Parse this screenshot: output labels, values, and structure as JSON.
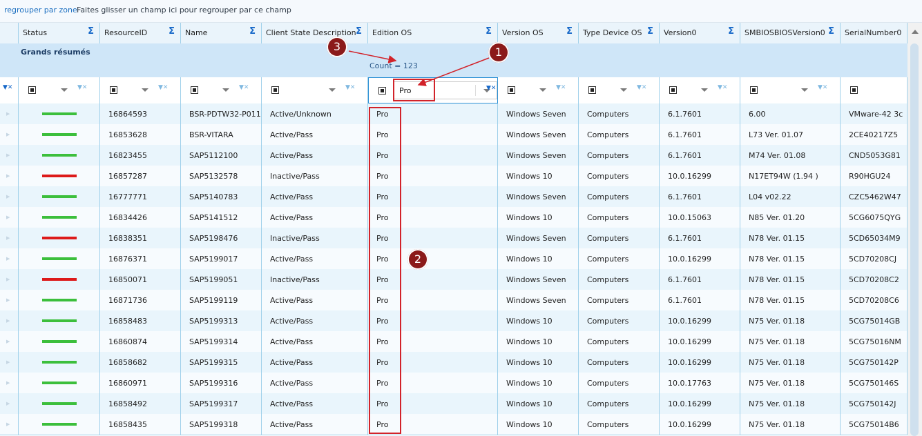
{
  "group_bar": {
    "label": "regrouper par zone",
    "hint": "Faites glisser un champ ici pour regrouper par ce champ"
  },
  "columns": [
    "Status",
    "ResourceID",
    "Name",
    "Client State Description",
    "Edition OS",
    "Version OS",
    "Type Device OS",
    "Version0",
    "SMBIOSBIOSVersion0",
    "SerialNumber0"
  ],
  "summary": {
    "title": "Grands résumés",
    "count_text": "Count = 123"
  },
  "filter": {
    "edition_os_value": "Pro"
  },
  "annotations": [
    "1",
    "2",
    "3"
  ],
  "status_colors": {
    "active": "#3cbf3c",
    "inactive": "#dd1a1a"
  },
  "rows": [
    {
      "status": "active",
      "id": "16864593",
      "name": "BSR-PDTW32-P011",
      "state": "Active/Unknown",
      "edition": "Pro",
      "version": "Windows Seven",
      "type": "Computers",
      "v0": "6.1.7601",
      "bios": "6.00",
      "serial": "VMware-42 3c"
    },
    {
      "status": "active",
      "id": "16853628",
      "name": "BSR-VITARA",
      "state": "Active/Pass",
      "edition": "Pro",
      "version": "Windows Seven",
      "type": "Computers",
      "v0": "6.1.7601",
      "bios": "L73 Ver. 01.07",
      "serial": "2CE40217Z5"
    },
    {
      "status": "active",
      "id": "16823455",
      "name": "SAP5112100",
      "state": "Active/Pass",
      "edition": "Pro",
      "version": "Windows Seven",
      "type": "Computers",
      "v0": "6.1.7601",
      "bios": "M74 Ver. 01.08",
      "serial": "CND5053G81"
    },
    {
      "status": "inactive",
      "id": "16857287",
      "name": "SAP5132578",
      "state": "Inactive/Pass",
      "edition": "Pro",
      "version": "Windows 10",
      "type": "Computers",
      "v0": "10.0.16299",
      "bios": "N17ET94W (1.94 )",
      "serial": "R90HGU24"
    },
    {
      "status": "active",
      "id": "16777771",
      "name": "SAP5140783",
      "state": "Active/Pass",
      "edition": "Pro",
      "version": "Windows Seven",
      "type": "Computers",
      "v0": "6.1.7601",
      "bios": "L04 v02.22",
      "serial": "CZC5462W47"
    },
    {
      "status": "active",
      "id": "16834426",
      "name": "SAP5141512",
      "state": "Active/Pass",
      "edition": "Pro",
      "version": "Windows 10",
      "type": "Computers",
      "v0": "10.0.15063",
      "bios": "N85 Ver. 01.20",
      "serial": "5CG6075QYG"
    },
    {
      "status": "inactive",
      "id": "16838351",
      "name": "SAP5198476",
      "state": "Inactive/Pass",
      "edition": "Pro",
      "version": "Windows Seven",
      "type": "Computers",
      "v0": "6.1.7601",
      "bios": "N78 Ver. 01.15",
      "serial": "5CD65034M9"
    },
    {
      "status": "active",
      "id": "16876371",
      "name": "SAP5199017",
      "state": "Active/Pass",
      "edition": "Pro",
      "version": "Windows 10",
      "type": "Computers",
      "v0": "10.0.16299",
      "bios": "N78 Ver. 01.15",
      "serial": "5CD70208CJ"
    },
    {
      "status": "inactive",
      "id": "16850071",
      "name": "SAP5199051",
      "state": "Inactive/Pass",
      "edition": "Pro",
      "version": "Windows Seven",
      "type": "Computers",
      "v0": "6.1.7601",
      "bios": "N78 Ver. 01.15",
      "serial": "5CD70208C2"
    },
    {
      "status": "active",
      "id": "16871736",
      "name": "SAP5199119",
      "state": "Active/Pass",
      "edition": "Pro",
      "version": "Windows Seven",
      "type": "Computers",
      "v0": "6.1.7601",
      "bios": "N78 Ver. 01.15",
      "serial": "5CD70208C6"
    },
    {
      "status": "active",
      "id": "16858483",
      "name": "SAP5199313",
      "state": "Active/Pass",
      "edition": "Pro",
      "version": "Windows 10",
      "type": "Computers",
      "v0": "10.0.16299",
      "bios": "N75 Ver. 01.18",
      "serial": "5CG75014GB"
    },
    {
      "status": "active",
      "id": "16860874",
      "name": "SAP5199314",
      "state": "Active/Pass",
      "edition": "Pro",
      "version": "Windows 10",
      "type": "Computers",
      "v0": "10.0.16299",
      "bios": "N75 Ver. 01.18",
      "serial": "5CG75016NM"
    },
    {
      "status": "active",
      "id": "16858682",
      "name": "SAP5199315",
      "state": "Active/Pass",
      "edition": "Pro",
      "version": "Windows 10",
      "type": "Computers",
      "v0": "10.0.16299",
      "bios": "N75 Ver. 01.18",
      "serial": "5CG750142P"
    },
    {
      "status": "active",
      "id": "16860971",
      "name": "SAP5199316",
      "state": "Active/Pass",
      "edition": "Pro",
      "version": "Windows 10",
      "type": "Computers",
      "v0": "10.0.17763",
      "bios": "N75 Ver. 01.18",
      "serial": "5CG750146S"
    },
    {
      "status": "active",
      "id": "16858492",
      "name": "SAP5199317",
      "state": "Active/Pass",
      "edition": "Pro",
      "version": "Windows 10",
      "type": "Computers",
      "v0": "10.0.16299",
      "bios": "N75 Ver. 01.18",
      "serial": "5CG750142J"
    },
    {
      "status": "active",
      "id": "16858435",
      "name": "SAP5199318",
      "state": "Active/Pass",
      "edition": "Pro",
      "version": "Windows 10",
      "type": "Computers",
      "v0": "10.0.16299",
      "bios": "N75 Ver. 01.18",
      "serial": "5CG75014B6"
    }
  ]
}
